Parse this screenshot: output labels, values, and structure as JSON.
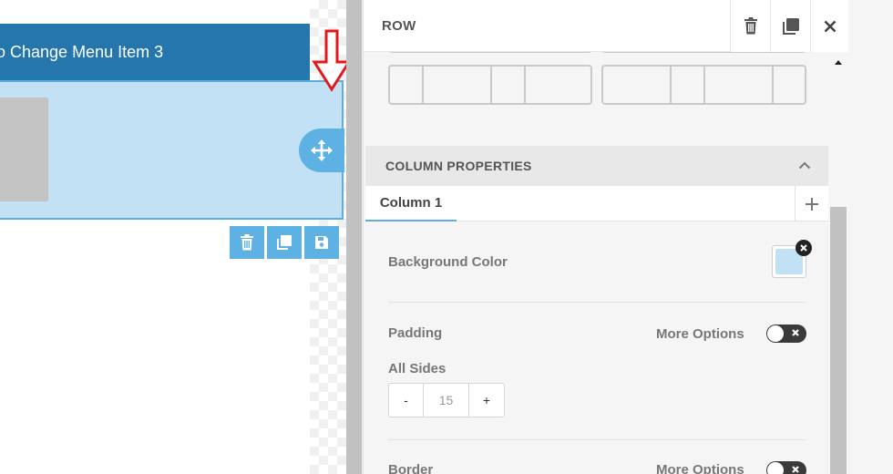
{
  "canvas": {
    "menu_bar_text": "o Change Menu Item 3"
  },
  "panel": {
    "title": "ROW",
    "column_properties": {
      "title": "COLUMN PROPERTIES",
      "tabs": [
        {
          "label": "Column 1",
          "active": true
        }
      ],
      "background_color": {
        "label": "Background Color",
        "value": "#c3e1f4"
      },
      "padding": {
        "label": "Padding",
        "more_options_label": "More Options",
        "all_sides_label": "All Sides",
        "value": "15",
        "minus_label": "-",
        "plus_label": "+"
      },
      "border": {
        "label": "Border",
        "more_options_label": "More Options"
      }
    }
  },
  "icons": {
    "move": "move-arrows-icon",
    "delete": "trash-icon",
    "copy": "duplicate-icon",
    "save": "floppy-icon",
    "close": "close-icon",
    "collapse": "chevron-up-icon",
    "add": "plus-icon",
    "annotation": "red-down-arrow"
  },
  "colors": {
    "menu_bar": "#2476ad",
    "column_highlight": "#c3e1f4",
    "accent": "#5db2e3",
    "annotation_arrow": "#e0191b"
  }
}
